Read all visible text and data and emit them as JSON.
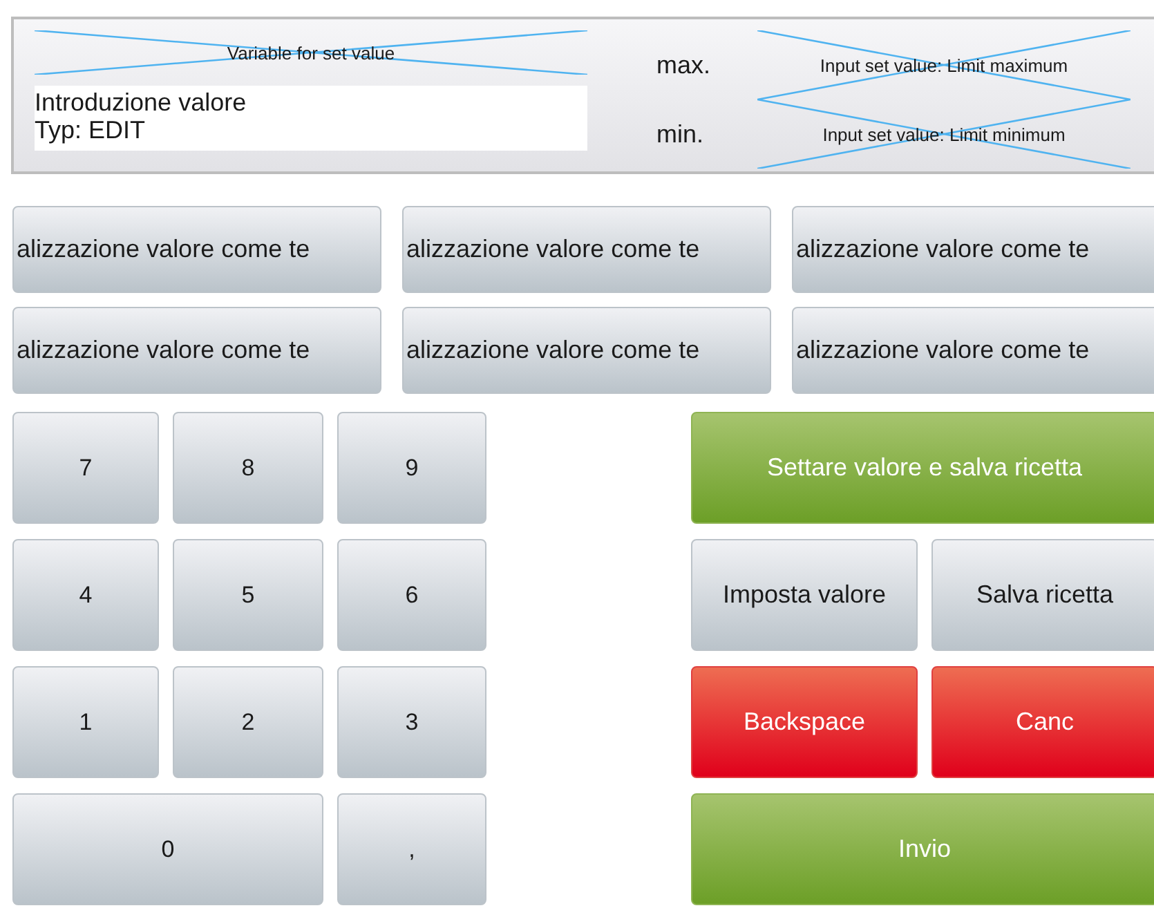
{
  "header": {
    "variable_label": "Variable for set value",
    "input_field": {
      "lines": [
        "Introduzione valore",
        "Typ: EDIT"
      ]
    },
    "limits": [
      {
        "label": "max.",
        "value": "Input set value: Limit maximum"
      },
      {
        "label": "min.",
        "value": "Input set value: Limit minimum"
      }
    ]
  },
  "text_buttons": [
    "alizzazione valore come te",
    "alizzazione valore come te",
    "alizzazione valore come te",
    "alizzazione valore come te",
    "alizzazione valore come te",
    "alizzazione valore come te"
  ],
  "keypad": [
    {
      "label": "7",
      "wide": false
    },
    {
      "label": "8",
      "wide": false
    },
    {
      "label": "9",
      "wide": false
    },
    {
      "label": "4",
      "wide": false
    },
    {
      "label": "5",
      "wide": false
    },
    {
      "label": "6",
      "wide": false
    },
    {
      "label": "1",
      "wide": false
    },
    {
      "label": "2",
      "wide": false
    },
    {
      "label": "3",
      "wide": false
    },
    {
      "label": "0",
      "wide": true
    },
    {
      "label": ",",
      "wide": false
    }
  ],
  "actions": [
    {
      "label": "Settare valore e salva ricetta",
      "kind": "confirm",
      "wide": true
    },
    {
      "label": "Imposta valore",
      "kind": "neutral",
      "wide": false
    },
    {
      "label": "Salva ricetta",
      "kind": "neutral",
      "wide": false
    },
    {
      "label": "Backspace",
      "kind": "danger",
      "wide": false
    },
    {
      "label": "Canc",
      "kind": "danger",
      "wide": false
    },
    {
      "label": "Invio",
      "kind": "confirm",
      "wide": true
    }
  ]
}
